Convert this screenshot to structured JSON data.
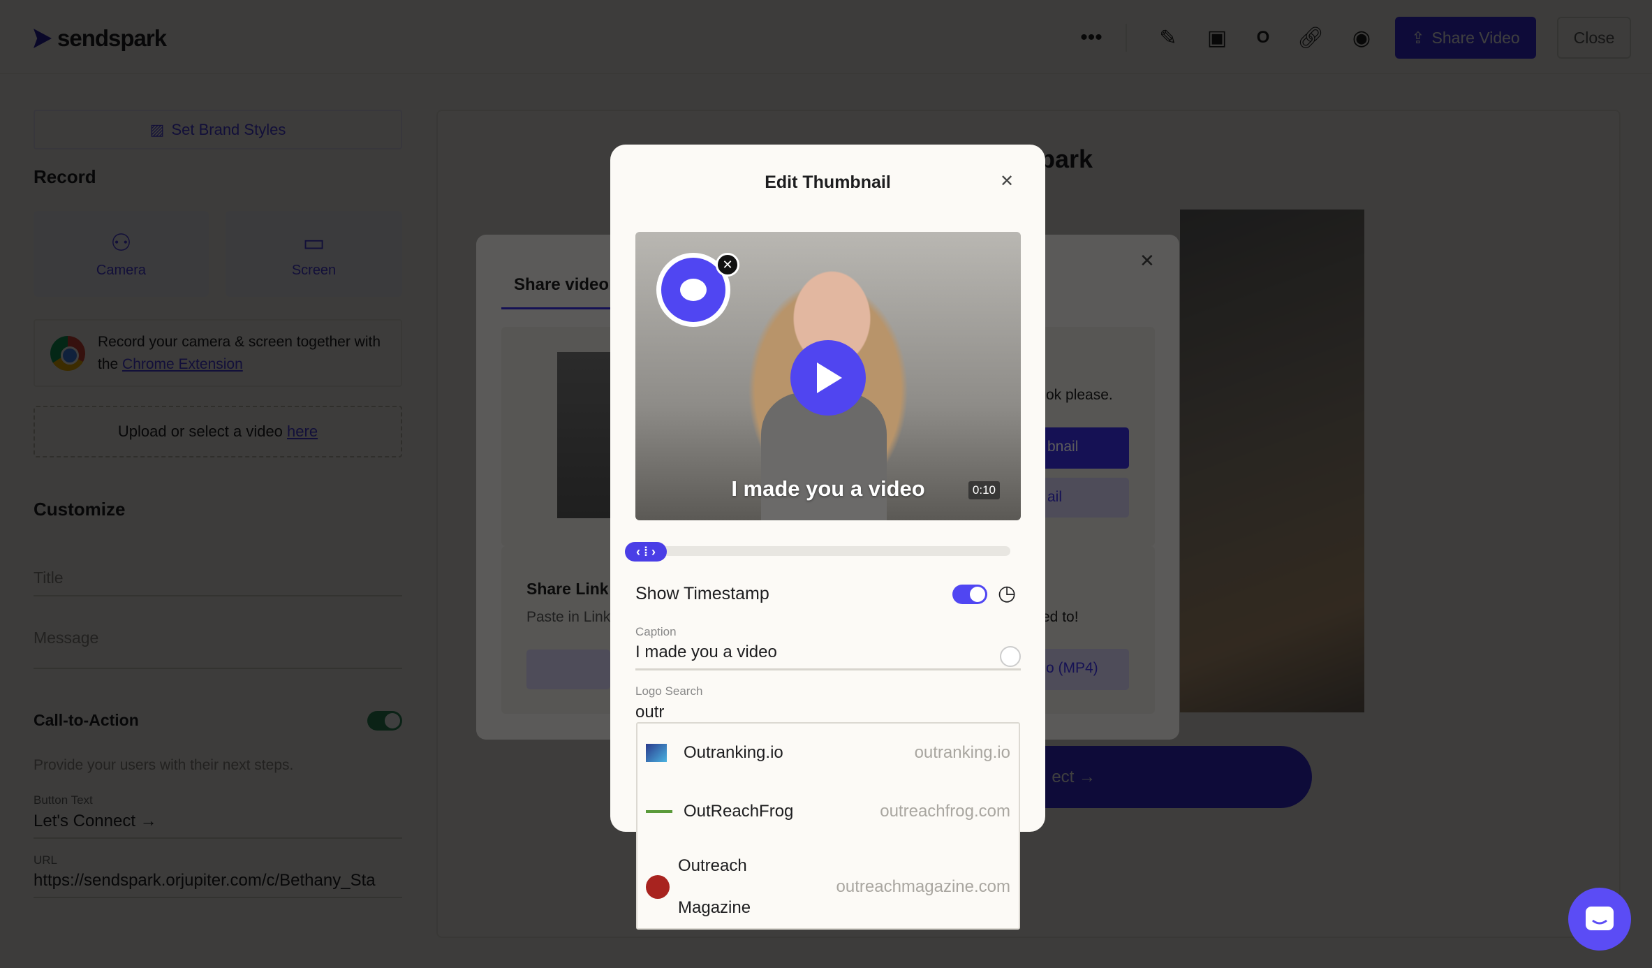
{
  "header": {
    "logo": "sendspark",
    "share_video": "Share Video",
    "close": "Close",
    "icons": [
      "more-icon",
      "edit-icon",
      "thumbnail-icon",
      "outlook-icon",
      "link-icon",
      "preview-icon"
    ]
  },
  "left": {
    "brand_styles": "Set Brand Styles",
    "record_heading": "Record",
    "camera": "Camera",
    "screen": "Screen",
    "chrome_text": "Record your camera & screen together with the ",
    "chrome_link": "Chrome Extension",
    "upload_text": "Upload or select a video ",
    "upload_link": "here",
    "customize_heading": "Customize",
    "title_placeholder": "Title",
    "message_placeholder": "Message",
    "cta_heading": "Call-to-Action",
    "cta_enabled": true,
    "cta_desc": "Provide your users with their next steps.",
    "button_text_label": "Button Text",
    "button_text_value": "Let's Connect →",
    "url_label": "URL",
    "url_value": "https://sendspark.orjupiter.com/c/Bethany_Sta"
  },
  "main": {
    "brand_partial": "park",
    "cta_partial": "ect →"
  },
  "share_modal": {
    "tab": "Share video",
    "text_partial": "ok please.",
    "btn1_partial": "bnail",
    "btn2_partial": "ail",
    "share_link_heading": "Share Link",
    "share_link_desc": "Paste in Link",
    "text2_partial": "ed to!",
    "btn3_partial": "o (MP4)"
  },
  "edit_modal": {
    "title": "Edit Thumbnail",
    "video_caption": "I made you a video",
    "duration": "0:10",
    "show_timestamp": "Show Timestamp",
    "timestamp_on": true,
    "caption_label": "Caption",
    "caption_value": "I made you a video",
    "logo_search_label": "Logo Search",
    "logo_search_value": "outr",
    "results": [
      {
        "name": "Outranking.io",
        "domain": "outranking.io"
      },
      {
        "name": "OutReachFrog",
        "domain": "outreachfrog.com"
      },
      {
        "name": "Outreach Magazine",
        "domain": "outreachmagazine.com"
      }
    ]
  },
  "colors": {
    "accent": "#3a2ee8",
    "toggle_green": "#2e8b57",
    "chat": "#5b4cf5"
  }
}
